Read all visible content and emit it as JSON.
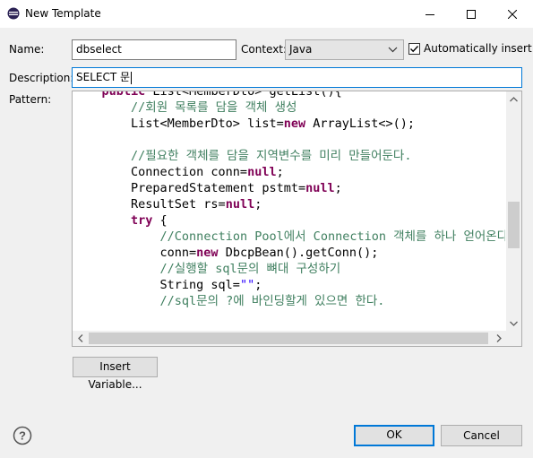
{
  "window": {
    "title": "New Template"
  },
  "form": {
    "name_label": "Name:",
    "name_value": "dbselect",
    "context_label": "Context:",
    "context_value": "Java",
    "auto_insert_label": "Automatically insert",
    "auto_insert_checked": true,
    "description_label": "Description:",
    "description_value": "SELECT 문",
    "pattern_label": "Pattern:"
  },
  "pattern": {
    "lines": [
      [
        {
          "t": "    "
        },
        {
          "t": "public",
          "c": "kw"
        },
        {
          "t": " List<MemberDto> getList(){"
        }
      ],
      [
        {
          "t": "        "
        },
        {
          "t": "//회원 목록를 담을 객체 생성",
          "c": "cm"
        }
      ],
      [
        {
          "t": "        List<MemberDto> list="
        },
        {
          "t": "new",
          "c": "kw"
        },
        {
          "t": " ArrayList<>();"
        }
      ],
      [
        {
          "t": ""
        }
      ],
      [
        {
          "t": "        "
        },
        {
          "t": "//필요한 객체를 담을 지역변수를 미리 만들어둔다.",
          "c": "cm"
        }
      ],
      [
        {
          "t": "        Connection conn="
        },
        {
          "t": "null",
          "c": "kw"
        },
        {
          "t": ";"
        }
      ],
      [
        {
          "t": "        PreparedStatement pstmt="
        },
        {
          "t": "null",
          "c": "kw"
        },
        {
          "t": ";"
        }
      ],
      [
        {
          "t": "        ResultSet rs="
        },
        {
          "t": "null",
          "c": "kw"
        },
        {
          "t": ";"
        }
      ],
      [
        {
          "t": "        "
        },
        {
          "t": "try",
          "c": "kw"
        },
        {
          "t": " {"
        }
      ],
      [
        {
          "t": "            "
        },
        {
          "t": "//Connection Pool에서 Connection 객체를 하나 얻어온다.",
          "c": "cm"
        }
      ],
      [
        {
          "t": "            conn="
        },
        {
          "t": "new",
          "c": "kw"
        },
        {
          "t": " DbcpBean().getConn();"
        }
      ],
      [
        {
          "t": "            "
        },
        {
          "t": "//실행할 sql문의 뼈대 구성하기",
          "c": "cm"
        }
      ],
      [
        {
          "t": "            String sql="
        },
        {
          "t": "\"\"",
          "c": "str"
        },
        {
          "t": ";"
        }
      ],
      [
        {
          "t": "            "
        },
        {
          "t": "//sql문의 ?에 바인딩할게 있으면 한다.",
          "c": "cm"
        }
      ]
    ]
  },
  "buttons": {
    "insert_variable": "Insert Variable...",
    "ok": "OK",
    "cancel": "Cancel"
  },
  "icons": {
    "app": "eclipse-icon",
    "minimize": "minimize-icon",
    "maximize": "maximize-icon",
    "close": "close-icon",
    "help": "help-icon"
  }
}
